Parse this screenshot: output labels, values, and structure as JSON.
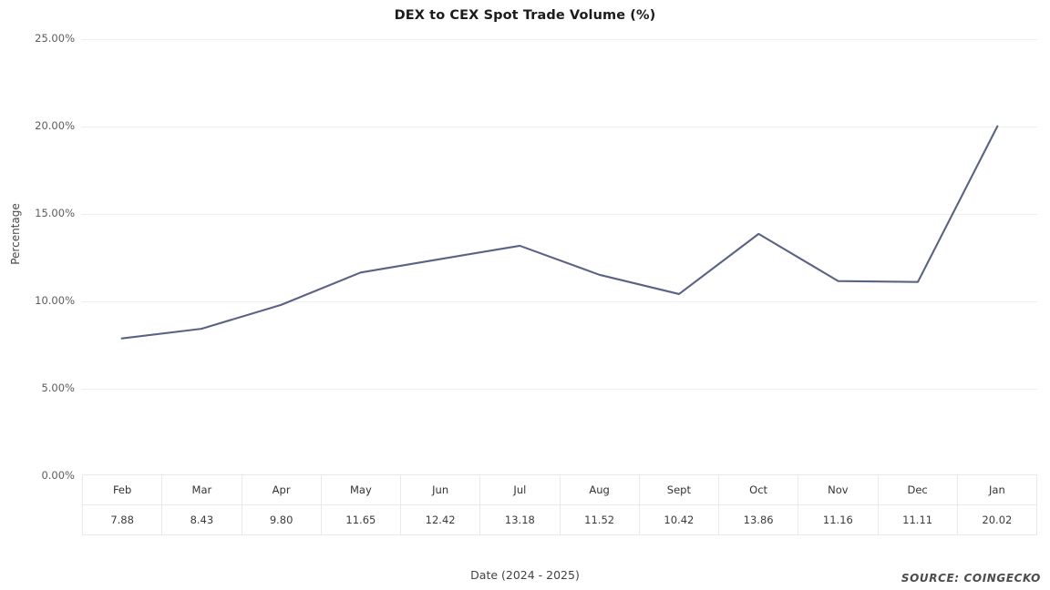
{
  "chart_data": {
    "type": "line",
    "title": "DEX to CEX Spot Trade Volume (%)",
    "xlabel": "Date (2024 - 2025)",
    "ylabel": "Percentage",
    "categories": [
      "Feb",
      "Mar",
      "Apr",
      "May",
      "Jun",
      "Jul",
      "Aug",
      "Sept",
      "Oct",
      "Nov",
      "Dec",
      "Jan"
    ],
    "values": [
      7.88,
      8.43,
      9.8,
      11.65,
      12.42,
      13.18,
      11.52,
      10.42,
      13.86,
      11.16,
      11.11,
      20.02
    ],
    "value_labels": [
      "7.88",
      "8.43",
      "9.80",
      "11.65",
      "12.42",
      "13.18",
      "11.52",
      "10.42",
      "13.86",
      "11.16",
      "11.11",
      "20.02"
    ],
    "ylim": [
      0,
      25
    ],
    "ytick_values": [
      25,
      20,
      15,
      10,
      5,
      0
    ],
    "ytick_labels": [
      "25.00%",
      "20.00%",
      "15.00%",
      "10.00%",
      "5.00%",
      "0.00%"
    ],
    "grid": true,
    "legend": "none",
    "series_color": "#5a6384",
    "grid_color": "#eceef1",
    "table_border_color": "#e8e9ec",
    "background_color": "#ffffff",
    "data_table_visible": true
  },
  "source": {
    "text": "SOURCE: COINGECKO"
  }
}
